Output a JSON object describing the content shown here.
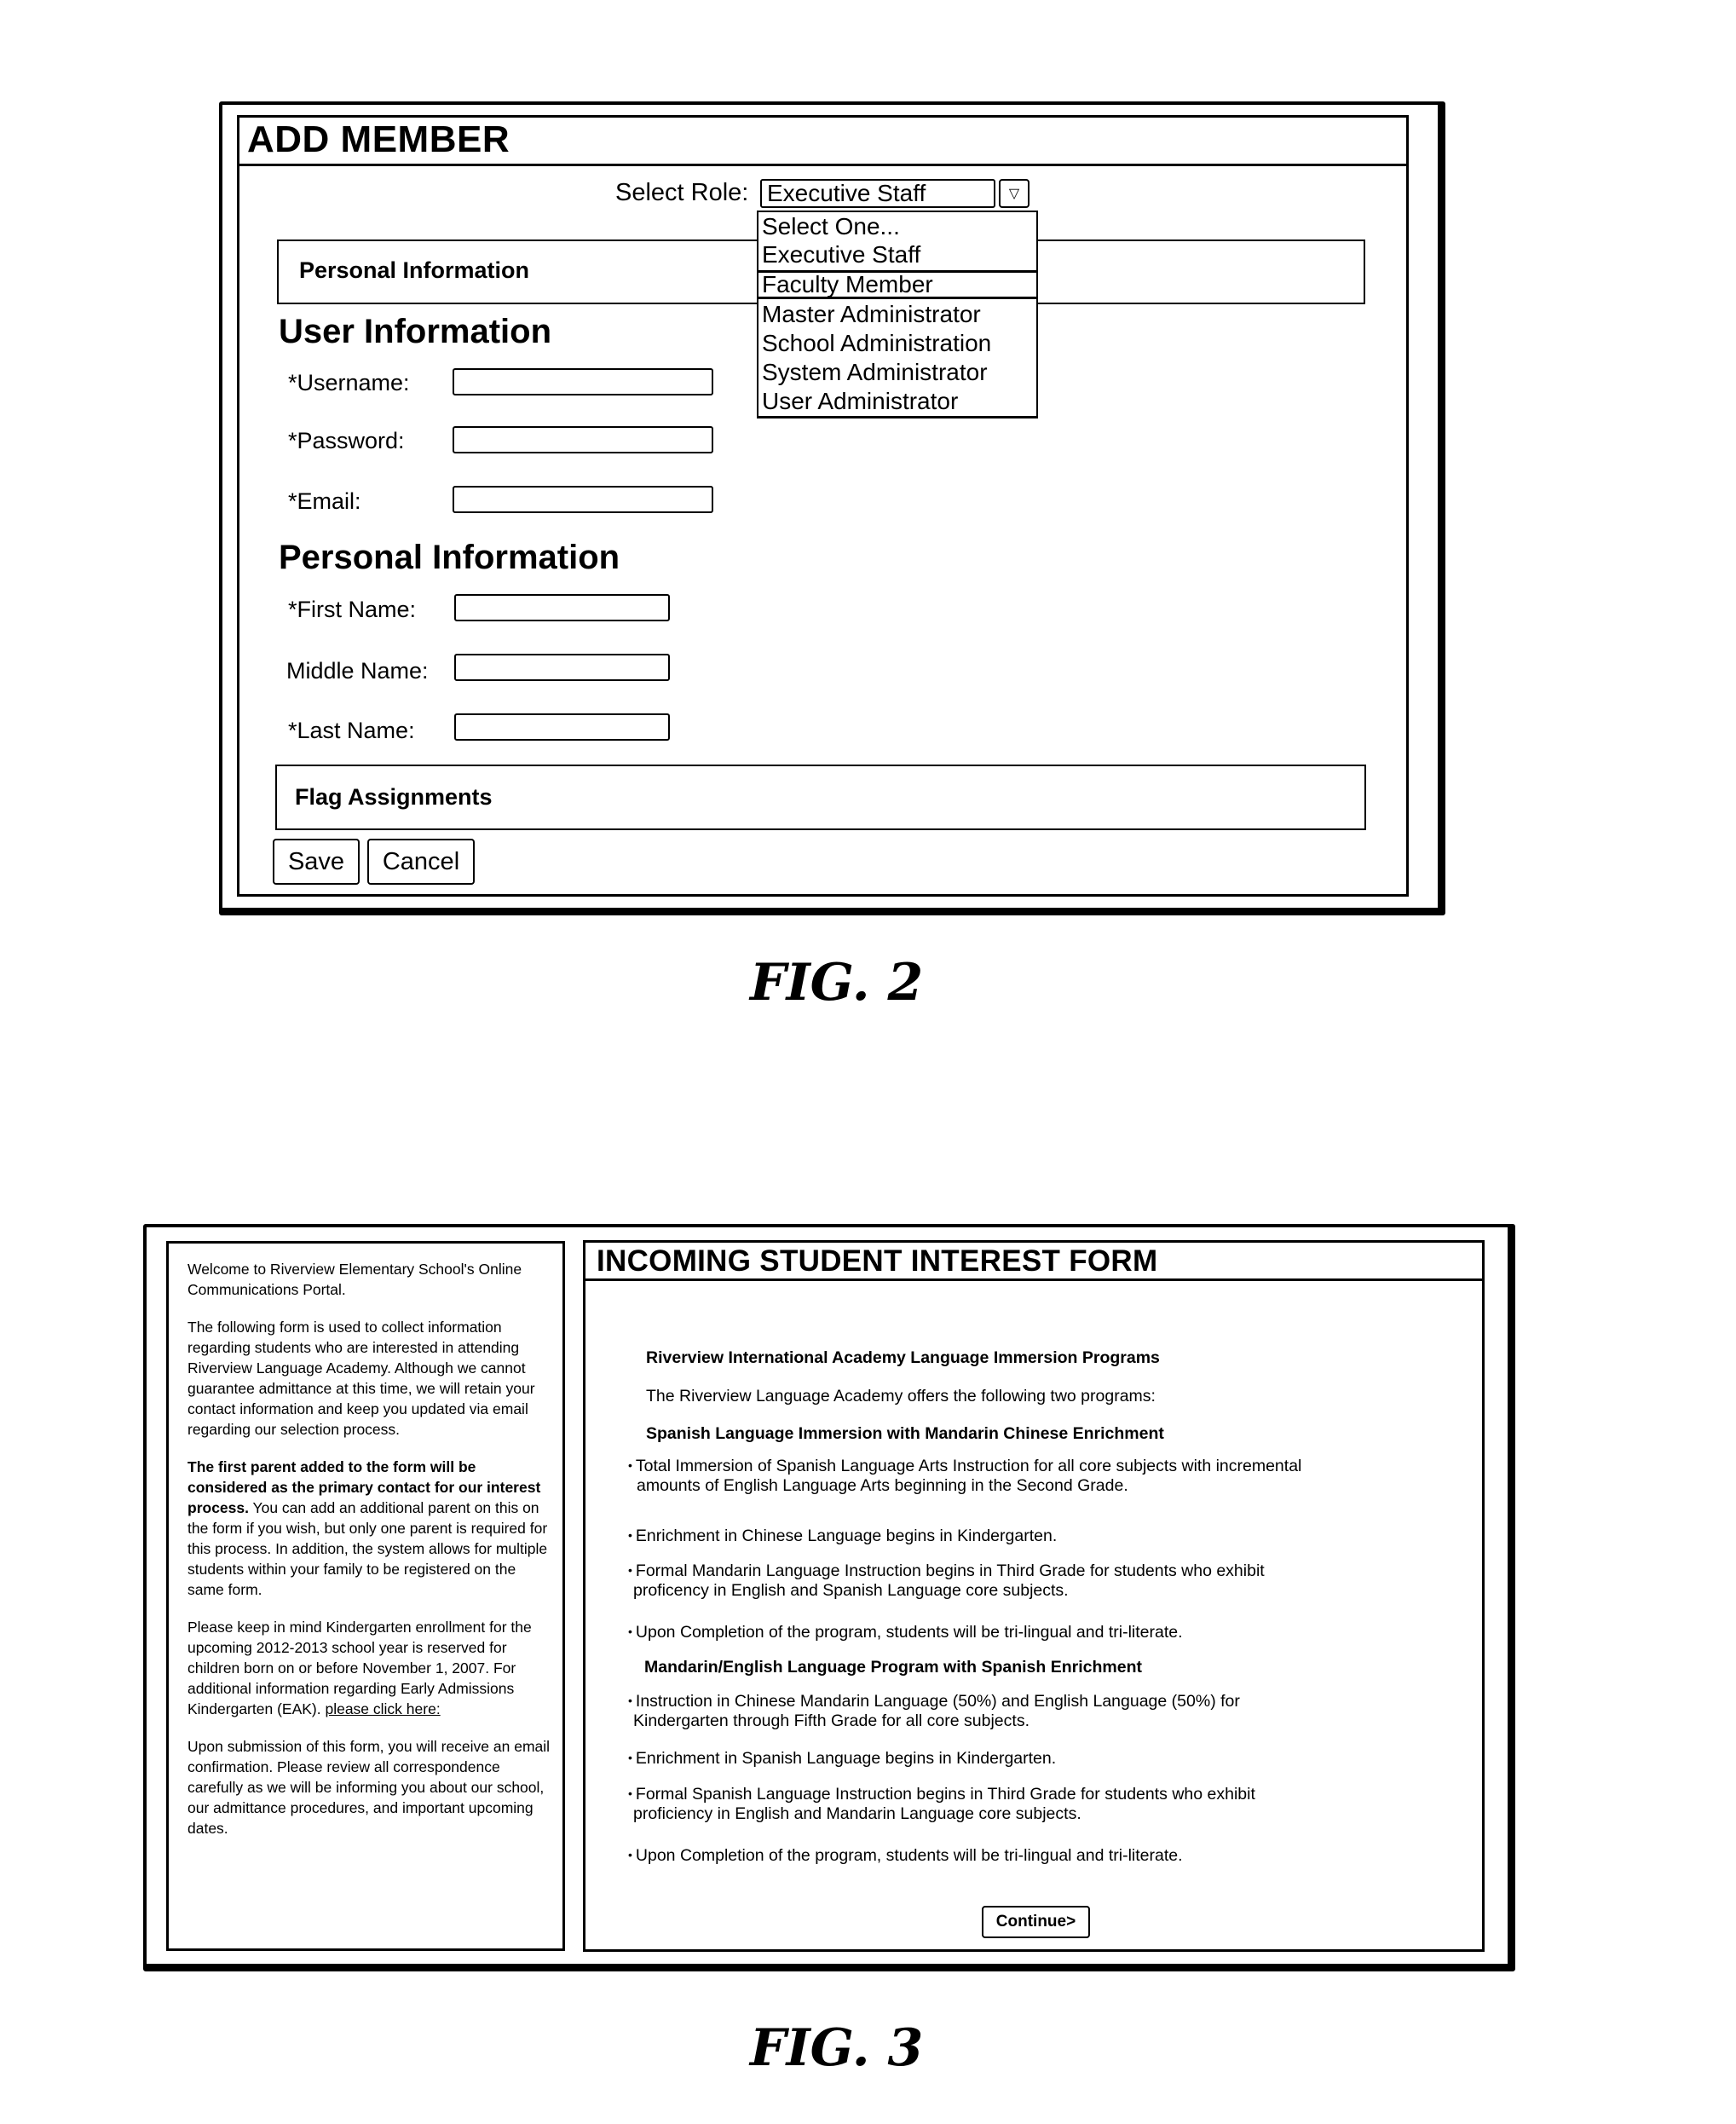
{
  "fig2": {
    "caption": "FIG. 2",
    "title": "ADD MEMBER",
    "select_role": {
      "label": "Select Role:",
      "value": "Executive Staff",
      "arrow_icon": "▽",
      "options": [
        "Select One...",
        "Executive Staff",
        "Faculty Member",
        "Master Administrator",
        "School Administration",
        "System Administrator",
        "User Administrator"
      ],
      "highlighted": "Faculty Member"
    },
    "personal_info_box": "Personal Information",
    "user_info_heading": "User Information",
    "user_fields": [
      {
        "label": "*Username:",
        "value": ""
      },
      {
        "label": "*Password:",
        "value": ""
      },
      {
        "label": "*Email:",
        "value": ""
      }
    ],
    "personal_info_heading": "Personal Information",
    "personal_fields": [
      {
        "label": "*First Name:",
        "value": ""
      },
      {
        "label": "Middle Name:",
        "value": ""
      },
      {
        "label": "*Last Name:",
        "value": ""
      }
    ],
    "flag_box": "Flag Assignments",
    "save_label": "Save",
    "cancel_label": "Cancel"
  },
  "fig3": {
    "caption": "FIG. 3",
    "sidebar": {
      "p1": "Welcome to Riverview Elementary School's Online Communications Portal.",
      "p2": "The following form is used to collect information regarding students who are interested in attending Riverview Language Academy. Although we cannot guarantee admittance at this time, we will retain your contact information and keep you updated via email regarding our selection process.",
      "p3_bold": "The first parent added to the form will be considered  as the primary contact for our interest process.",
      "p3_rest": " You can add an additional parent on this on the form if you wish, but only one parent is required for this process. In addition, the system allows for multiple students within your family to be registered on the same form.",
      "p4": "Please keep in mind Kindergarten enrollment for the upcoming 2012-2013 school year is reserved for children born on or before November 1, 2007. For additional information regarding Early Admissions Kindergarten (EAK). ",
      "p4_link": "please click here:",
      "p5": "Upon submission of this form, you will receive an email confirmation. Please review all correspondence carefully as we will be informing you about our school, our admittance procedures, and important upcoming dates."
    },
    "main": {
      "title": "INCOMING STUDENT INTEREST FORM",
      "heading": "Riverview International Academy Language Immersion Programs",
      "intro": "The Riverview Language Academy offers the following two programs:",
      "program1": {
        "title": "Spanish Language Immersion with Mandarin Chinese Enrichment",
        "bullets": [
          [
            "Total Immersion of Spanish Language Arts Instruction for all core subjects with incremental",
            "amounts of English Language Arts beginning in the Second Grade."
          ],
          [
            "Enrichment in Chinese Language begins in Kindergarten."
          ],
          [
            "Formal Mandarin Language Instruction begins in Third Grade for students who exhibit",
            "proficency in English and Spanish Language core subjects."
          ],
          [
            "Upon Completion of the program, students will be tri-lingual and tri-literate."
          ]
        ]
      },
      "program2": {
        "title": "Mandarin/English Language Program with Spanish Enrichment",
        "bullets": [
          [
            "Instruction in Chinese Mandarin Language (50%) and English Language (50%) for",
            "Kindergarten through Fifth Grade for all core subjects."
          ],
          [
            "Enrichment in Spanish Language begins in Kindergarten."
          ],
          [
            "Formal Spanish Language Instruction begins in Third Grade for students who exhibit",
            "proficiency in English and Mandarin Language core subjects."
          ],
          [
            "Upon Completion of the program, students will be tri-lingual and tri-literate."
          ]
        ]
      },
      "continue_label": "Continue>"
    }
  }
}
